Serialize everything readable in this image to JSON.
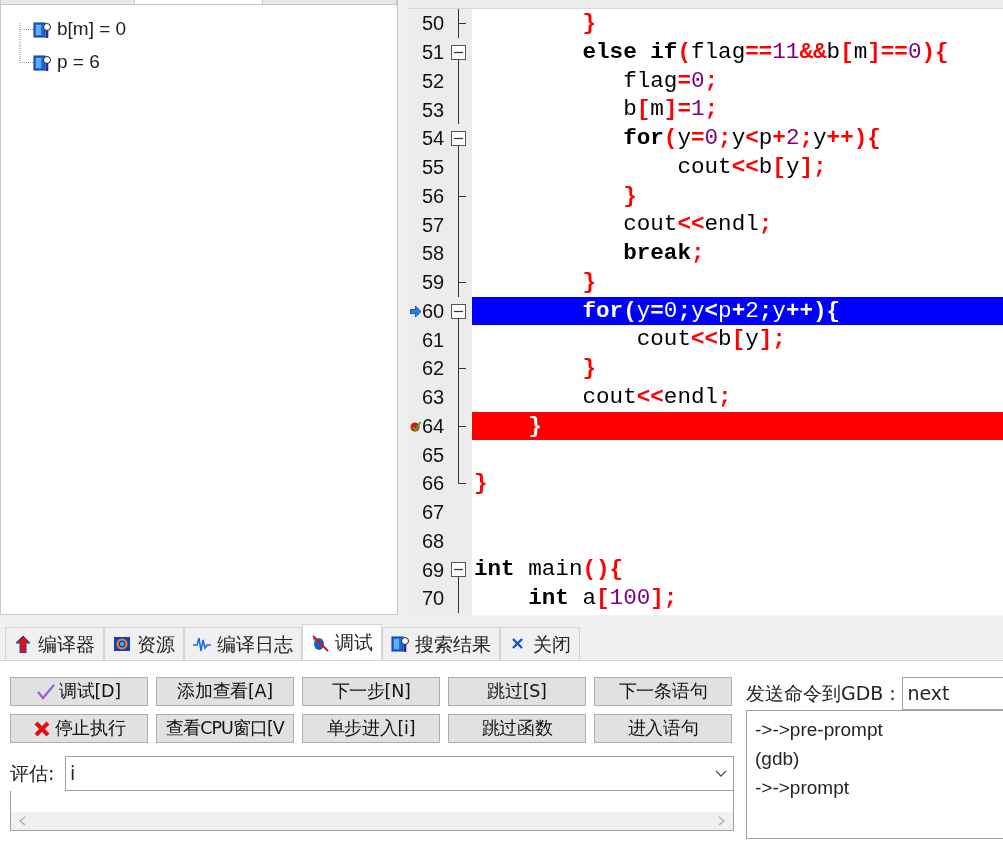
{
  "watch_tree": [
    {
      "label": "b[m] = 0"
    },
    {
      "label": "p = 6"
    }
  ],
  "editor": {
    "lines": [
      {
        "number": "50",
        "kind": "fold_end",
        "tokens": [
          {
            "kind": "op",
            "text": "        }"
          }
        ]
      },
      {
        "number": "51",
        "kind": "fold_start",
        "tokens": [
          {
            "kind": "kw",
            "text": "        else if"
          },
          {
            "kind": "op",
            "text": "("
          },
          {
            "kind": "id",
            "text": "flag"
          },
          {
            "kind": "op",
            "text": "=="
          },
          {
            "kind": "num",
            "text": "11"
          },
          {
            "kind": "op",
            "text": "&&"
          },
          {
            "kind": "id",
            "text": "b"
          },
          {
            "kind": "op",
            "text": "["
          },
          {
            "kind": "id",
            "text": "m"
          },
          {
            "kind": "op",
            "text": "]=="
          },
          {
            "kind": "num",
            "text": "0"
          },
          {
            "kind": "op",
            "text": "){"
          }
        ]
      },
      {
        "number": "52",
        "kind": "fold_body",
        "tokens": [
          {
            "kind": "id",
            "text": "           flag"
          },
          {
            "kind": "op",
            "text": "="
          },
          {
            "kind": "num",
            "text": "0"
          },
          {
            "kind": "op",
            "text": ";"
          }
        ]
      },
      {
        "number": "53",
        "kind": "fold_body",
        "tokens": [
          {
            "kind": "id",
            "text": "           b"
          },
          {
            "kind": "op",
            "text": "["
          },
          {
            "kind": "id",
            "text": "m"
          },
          {
            "kind": "op",
            "text": "]="
          },
          {
            "kind": "num",
            "text": "1"
          },
          {
            "kind": "op",
            "text": ";"
          }
        ]
      },
      {
        "number": "54",
        "kind": "fold_start",
        "tokens": [
          {
            "kind": "kw",
            "text": "           for"
          },
          {
            "kind": "op",
            "text": "("
          },
          {
            "kind": "id",
            "text": "y"
          },
          {
            "kind": "op",
            "text": "="
          },
          {
            "kind": "num",
            "text": "0"
          },
          {
            "kind": "op",
            "text": ";"
          },
          {
            "kind": "id",
            "text": "y"
          },
          {
            "kind": "op",
            "text": "<"
          },
          {
            "kind": "id",
            "text": "p"
          },
          {
            "kind": "op",
            "text": "+"
          },
          {
            "kind": "num",
            "text": "2"
          },
          {
            "kind": "op",
            "text": ";"
          },
          {
            "kind": "id",
            "text": "y"
          },
          {
            "kind": "op",
            "text": "++){"
          }
        ]
      },
      {
        "number": "55",
        "kind": "fold_body",
        "tokens": [
          {
            "kind": "id",
            "text": "               cout"
          },
          {
            "kind": "op",
            "text": "<<"
          },
          {
            "kind": "id",
            "text": "b"
          },
          {
            "kind": "op",
            "text": "["
          },
          {
            "kind": "id",
            "text": "y"
          },
          {
            "kind": "op",
            "text": "];"
          }
        ]
      },
      {
        "number": "56",
        "kind": "fold_end",
        "tokens": [
          {
            "kind": "op",
            "text": "           }"
          }
        ]
      },
      {
        "number": "57",
        "kind": "fold_body",
        "tokens": [
          {
            "kind": "id",
            "text": "           cout"
          },
          {
            "kind": "op",
            "text": "<<"
          },
          {
            "kind": "id",
            "text": "endl"
          },
          {
            "kind": "op",
            "text": ";"
          }
        ]
      },
      {
        "number": "58",
        "kind": "fold_body",
        "tokens": [
          {
            "kind": "kw",
            "text": "           break"
          },
          {
            "kind": "op",
            "text": ";"
          }
        ]
      },
      {
        "number": "59",
        "kind": "fold_end",
        "tokens": [
          {
            "kind": "op",
            "text": "        }"
          }
        ]
      },
      {
        "number": "60",
        "kind": "fold_start",
        "execution_point": true,
        "breakpoint": false,
        "tokens": [
          {
            "kind": "kw",
            "text": "        for"
          },
          {
            "kind": "op",
            "text": "("
          },
          {
            "kind": "id",
            "text": "y"
          },
          {
            "kind": "op",
            "text": "="
          },
          {
            "kind": "num",
            "text": "0"
          },
          {
            "kind": "op",
            "text": ";"
          },
          {
            "kind": "id",
            "text": "y"
          },
          {
            "kind": "op",
            "text": "<"
          },
          {
            "kind": "id",
            "text": "p"
          },
          {
            "kind": "op",
            "text": "+"
          },
          {
            "kind": "num",
            "text": "2"
          },
          {
            "kind": "op",
            "text": ";"
          },
          {
            "kind": "id",
            "text": "y"
          },
          {
            "kind": "op",
            "text": "++){"
          }
        ]
      },
      {
        "number": "61",
        "kind": "fold_body",
        "tokens": [
          {
            "kind": "id",
            "text": "            cout"
          },
          {
            "kind": "op",
            "text": "<<"
          },
          {
            "kind": "id",
            "text": "b"
          },
          {
            "kind": "op",
            "text": "["
          },
          {
            "kind": "id",
            "text": "y"
          },
          {
            "kind": "op",
            "text": "];"
          }
        ]
      },
      {
        "number": "62",
        "kind": "fold_end",
        "tokens": [
          {
            "kind": "op",
            "text": "        }"
          }
        ]
      },
      {
        "number": "63",
        "kind": "fold_body",
        "tokens": [
          {
            "kind": "id",
            "text": "        cout"
          },
          {
            "kind": "op",
            "text": "<<"
          },
          {
            "kind": "id",
            "text": "endl"
          },
          {
            "kind": "op",
            "text": ";"
          }
        ]
      },
      {
        "number": "64",
        "kind": "fold_end",
        "execution_point": false,
        "breakpoint": true,
        "tokens": [
          {
            "kind": "op",
            "text": "    }"
          }
        ]
      },
      {
        "number": "65",
        "kind": "fold_body"
      },
      {
        "number": "66",
        "kind": "fold_last",
        "tokens": [
          {
            "kind": "op",
            "text": "}"
          }
        ]
      },
      {
        "number": "67",
        "kind": "plain"
      },
      {
        "number": "68",
        "kind": "plain"
      },
      {
        "number": "69",
        "kind": "fold_start",
        "tokens": [
          {
            "kind": "kw",
            "text": "int"
          },
          {
            "kind": "id",
            "text": " main"
          },
          {
            "kind": "op",
            "text": "(){"
          }
        ]
      },
      {
        "number": "70",
        "kind": "fold_body",
        "tokens": [
          {
            "kind": "kw",
            "text": "    int"
          },
          {
            "kind": "id",
            "text": " a"
          },
          {
            "kind": "op",
            "text": "["
          },
          {
            "kind": "num",
            "text": "100"
          },
          {
            "kind": "op",
            "text": "];"
          }
        ]
      }
    ]
  },
  "bottom_tabs": [
    {
      "label": "编译器",
      "selected": false
    },
    {
      "label": "资源",
      "selected": false
    },
    {
      "label": "编译日志",
      "selected": false
    },
    {
      "label": "调试",
      "selected": true
    },
    {
      "label": "搜索结果",
      "selected": false
    },
    {
      "label": "关闭",
      "selected": false
    }
  ],
  "debug_buttons": [
    "调试[D]",
    "添加查看[A]",
    "下一步[N]",
    "跳过[S]",
    "下一条语句",
    "停止执行",
    "查看CPU窗口[V",
    "单步进入[i]",
    "跳过函数",
    "进入语句"
  ],
  "evaluate": {
    "label": "评估:",
    "value": "i"
  },
  "gdb": {
    "label": "发送命令到GDB：",
    "value": "next",
    "output": [
      "->->pre-prompt",
      "(gdb)",
      "->->prompt"
    ]
  }
}
